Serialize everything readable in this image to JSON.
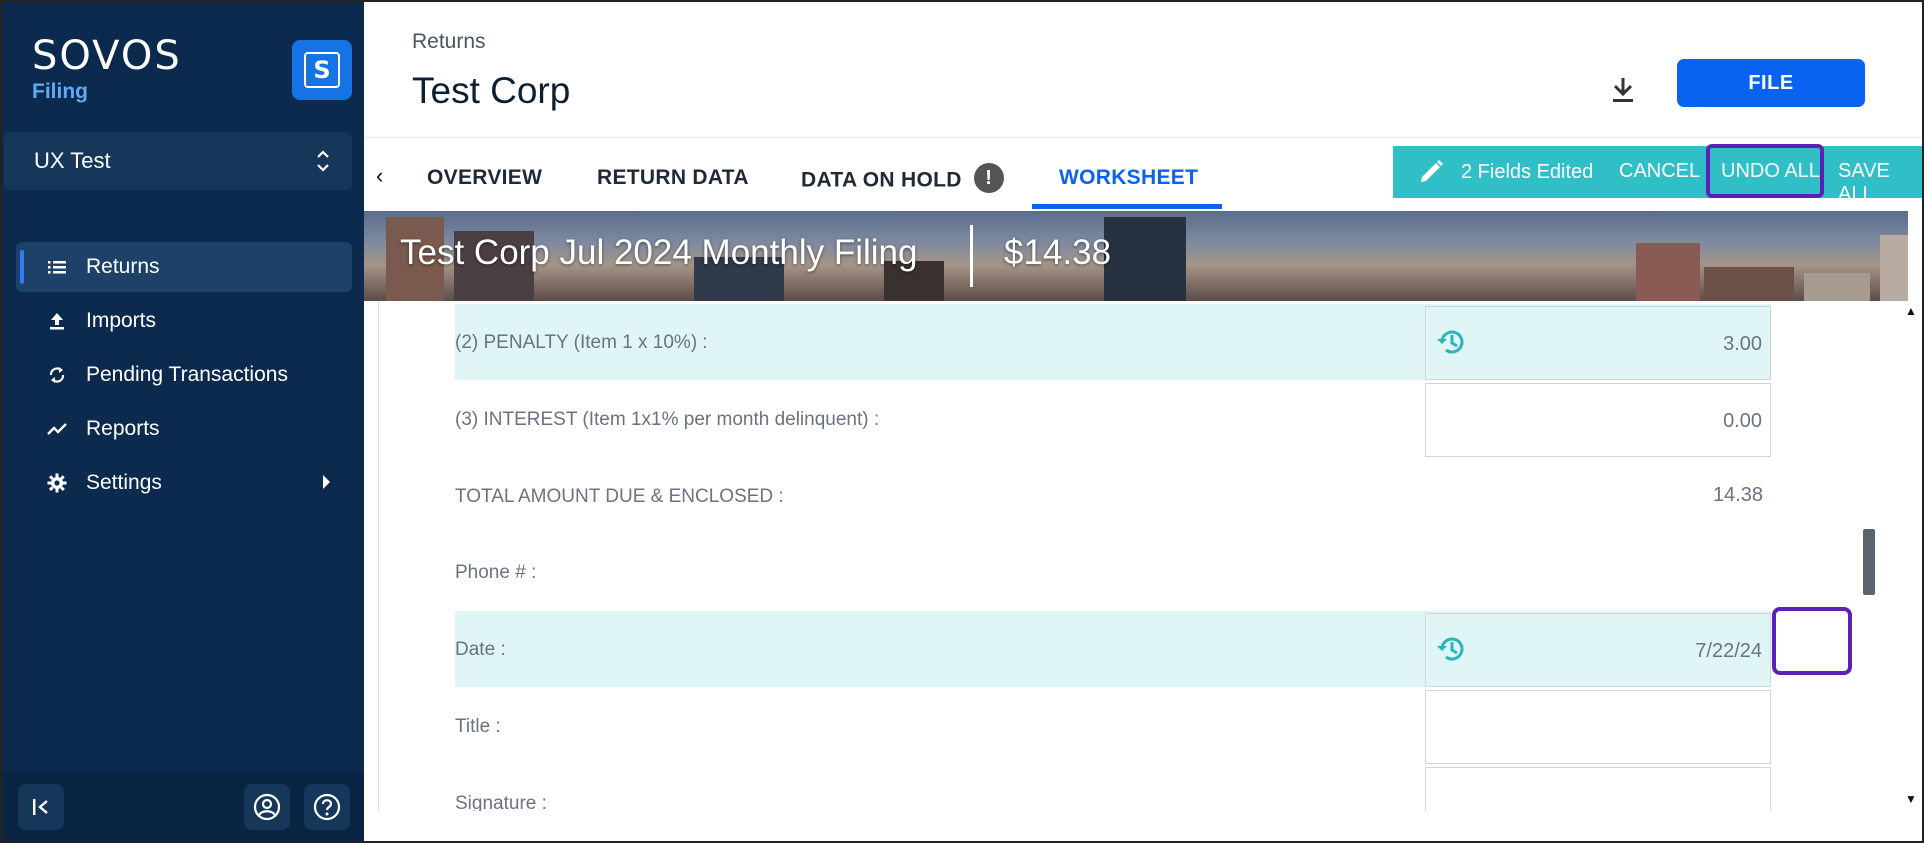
{
  "sidebar": {
    "brand_name": "SOVOS",
    "brand_sub": "Filing",
    "logo_letter": "S",
    "workspace": "UX Test",
    "items": [
      {
        "label": "Returns",
        "icon": "list-icon",
        "active": true
      },
      {
        "label": "Imports",
        "icon": "upload-icon"
      },
      {
        "label": "Pending Transactions",
        "icon": "sync-icon"
      },
      {
        "label": "Reports",
        "icon": "trend-icon"
      },
      {
        "label": "Settings",
        "icon": "gear-icon",
        "has_submenu": true
      }
    ],
    "footer": {
      "collapse_icon": "collapse-icon",
      "account_icon": "account-icon",
      "help_icon": "help-icon"
    }
  },
  "header": {
    "breadcrumb": "Returns",
    "title": "Test Corp",
    "file_label": "FILE"
  },
  "tabs": {
    "items": [
      "OVERVIEW",
      "RETURN DATA",
      "DATA ON HOLD",
      "WORKSHEET"
    ],
    "active": "WORKSHEET",
    "hold_badge": "!"
  },
  "edit_bar": {
    "count_label": "2 Fields Edited",
    "cancel": "CANCEL",
    "undo_all": "UNDO ALL",
    "save_all": "SAVE ALL"
  },
  "banner": {
    "title": "Test Corp Jul 2024 Monthly Filing",
    "amount": "$14.38"
  },
  "worksheet": {
    "rows": [
      {
        "label": "(2) PENALTY (Item 1 x 10%) :",
        "value": "3.00",
        "edited": true
      },
      {
        "label": "(3) INTEREST (Item 1x1% per month delinquent) :",
        "value": "0.00",
        "edited": false
      },
      {
        "label": "TOTAL AMOUNT DUE & ENCLOSED :",
        "value": "14.38",
        "readonly": true
      },
      {
        "label": "Phone # :",
        "value": "",
        "readonly": true
      },
      {
        "label": "Date :",
        "value": "7/22/24",
        "edited": true
      },
      {
        "label": "Title :",
        "value": "",
        "edited": false
      },
      {
        "label": "Signature :",
        "value": "",
        "edited": false
      }
    ]
  },
  "colors": {
    "sidebar_bg": "#0b2a4d",
    "accent": "#0a63f0",
    "edit_bar": "#30bec7",
    "highlight_row": "#dff5f6",
    "focus_outline": "#5b21b6"
  }
}
